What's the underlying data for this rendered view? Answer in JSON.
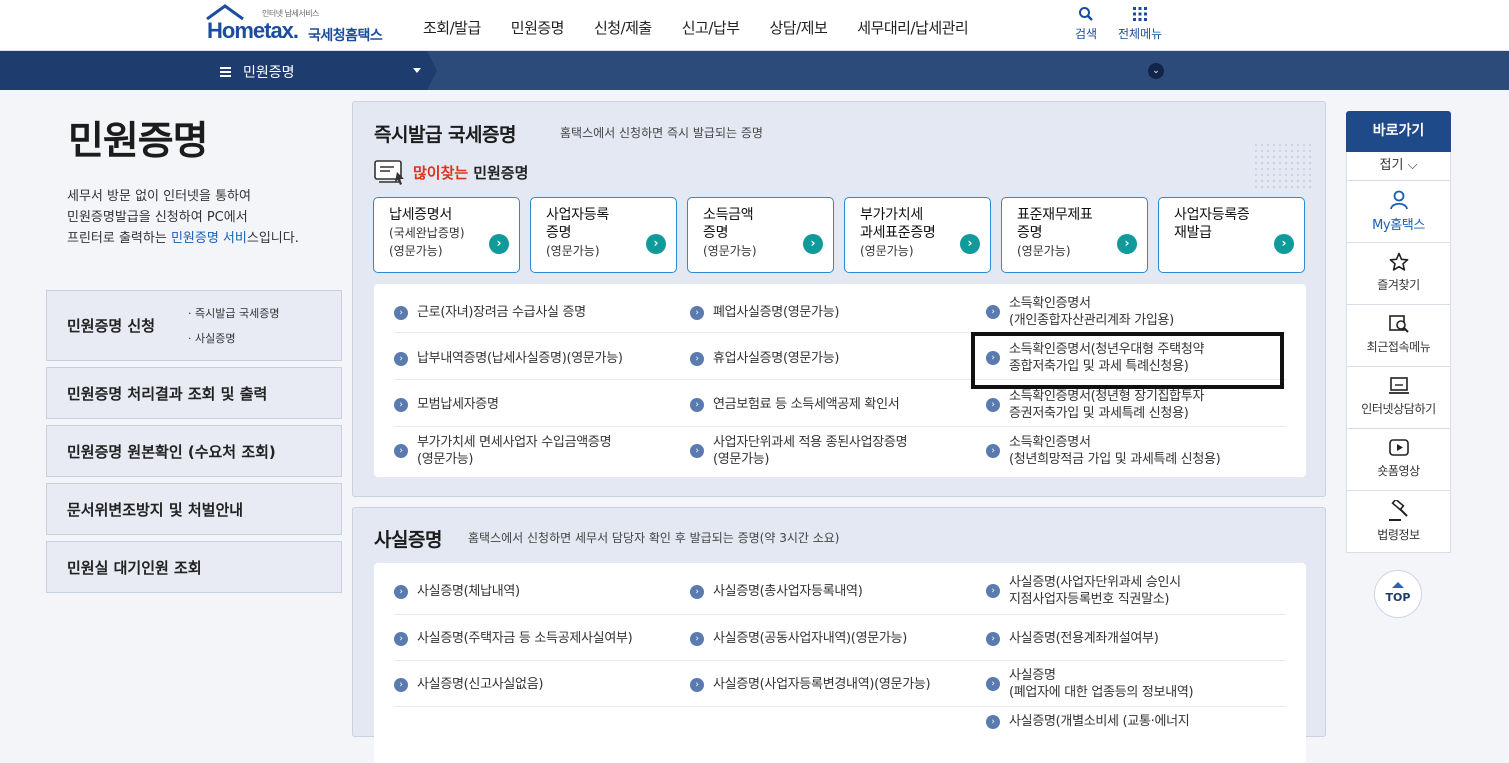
{
  "header": {
    "logo_small": "인터넷 납세서비스",
    "logo_word": "Hometax.",
    "logo_kr": "국세청홈택스",
    "nav": [
      "조회/발급",
      "민원증명",
      "신청/제출",
      "신고/납부",
      "상담/제보",
      "세무대리/납세관리"
    ],
    "search_label": "검색",
    "allmenu_label": "전체메뉴"
  },
  "subbar": {
    "menu_label": "민원증명"
  },
  "left": {
    "title": "민원증명",
    "desc_line1": "세무서 방문 없이 인터넷을 통하여",
    "desc_line2": "민원증명발급을 신청하여 PC에서",
    "desc_line3_pre": "프린터로 출력하는 ",
    "desc_line3_link": "민원증명 서비",
    "desc_line3_post": "스입니다.",
    "menus": [
      {
        "label": "민원증명 신청",
        "subs": [
          "· 즉시발급 국세증명",
          "· 사실증명"
        ]
      },
      {
        "label": "민원증명 처리결과 조회 및 출력"
      },
      {
        "label": "민원증명 원본확인 (수요처 조회)"
      },
      {
        "label": "문서위변조방지 및 처벌안내"
      },
      {
        "label": "민원실 대기인원 조회"
      }
    ]
  },
  "instant": {
    "title": "즉시발급 국세증명",
    "desc": "홈택스에서 신청하면 즉시 발급되는 증명",
    "popular_hi": "많이찾는",
    "popular_rest": "민원증명",
    "cards": [
      {
        "title": "납세증명서",
        "sub": "(국세완납증명)\n(영문가능)"
      },
      {
        "title": "사업자등록\n증명",
        "sub": "(영문가능)"
      },
      {
        "title": "소득금액\n증명",
        "sub": "(영문가능)"
      },
      {
        "title": "부가가치세\n과세표준증명",
        "sub": "(영문가능)"
      },
      {
        "title": "표준재무제표\n증명",
        "sub": "(영문가능)"
      },
      {
        "title": "사업자등록증\n재발급",
        "sub": ""
      }
    ],
    "items": [
      [
        "근로(자녀)장려금 수급사실 증명",
        "폐업사실증명(영문가능)",
        "소득확인증명서\n(개인종합자산관리계좌 가입용)"
      ],
      [
        "납부내역증명(납세사실증명)(영문가능)",
        "휴업사실증명(영문가능)",
        "소득확인증명서(청년우대형 주택청약\n종합저축가입 및 과세 특례신청용)"
      ],
      [
        "모범납세자증명",
        "연금보험료 등 소득세액공제 확인서",
        "소득확인증명서(청년형 장기집합투자\n증권저축가입 및 과세특례 신청용)"
      ],
      [
        "부가가치세 면세사업자 수입금액증명\n(영문가능)",
        "사업자단위과세 적용 종된사업장증명\n(영문가능)",
        "소득확인증명서\n(청년희망적금 가입 및 과세특례 신청용)"
      ]
    ]
  },
  "fact": {
    "title": "사실증명",
    "desc": "홈택스에서 신청하면 세무서 담당자 확인 후 발급되는 증명(약 3시간 소요)",
    "items": [
      [
        "사실증명(체납내역)",
        "사실증명(총사업자등록내역)",
        "사실증명(사업자단위과세 승인시\n지점사업자등록번호 직권말소)"
      ],
      [
        "사실증명(주택자금 등 소득공제사실여부)",
        "사실증명(공동사업자내역)(영문가능)",
        "사실증명(전용계좌개설여부)"
      ],
      [
        "사실증명(신고사실없음)",
        "사실증명(사업자등록변경내역)(영문가능)",
        "사실증명\n(폐업자에 대한 업종등의 정보내역)"
      ],
      [
        "",
        "",
        "사실증명(개별소비세 (교통·에너지"
      ]
    ]
  },
  "quick": {
    "head": "바로가기",
    "fold": "접기 ⌵",
    "items": [
      {
        "icon": "user-icon",
        "label": "My홈택스"
      },
      {
        "icon": "star-icon",
        "label": "즐겨찾기"
      },
      {
        "icon": "recent-search-icon",
        "label": "최근접속메뉴"
      },
      {
        "icon": "monitor-chat-icon",
        "label": "인터넷상담하기"
      },
      {
        "icon": "play-icon",
        "label": "숏폼영상"
      },
      {
        "icon": "gavel-icon",
        "label": "법령정보"
      }
    ],
    "top": "TOP"
  }
}
